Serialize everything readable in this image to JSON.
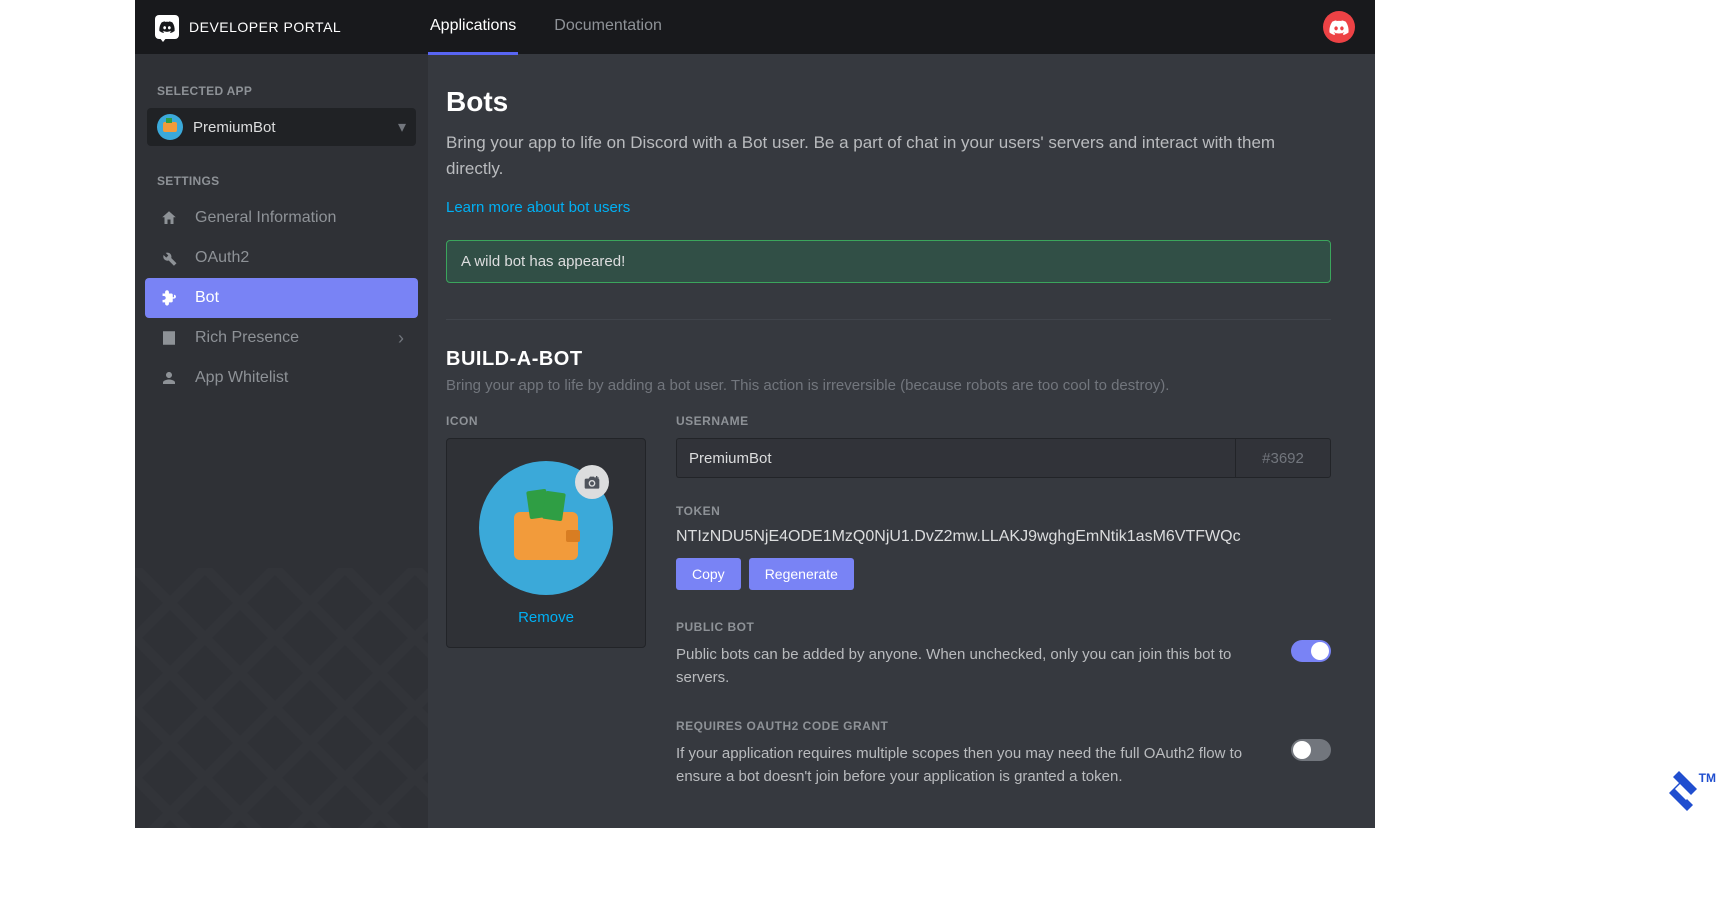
{
  "header": {
    "portal_title": "DEVELOPER PORTAL",
    "tabs": {
      "applications": "Applications",
      "documentation": "Documentation"
    }
  },
  "sidebar": {
    "selected_app_label": "SELECTED APP",
    "selected_app_name": "PremiumBot",
    "settings_label": "SETTINGS",
    "items": [
      {
        "label": "General Information"
      },
      {
        "label": "OAuth2"
      },
      {
        "label": "Bot"
      },
      {
        "label": "Rich Presence"
      },
      {
        "label": "App Whitelist"
      }
    ]
  },
  "main": {
    "title": "Bots",
    "description": "Bring your app to life on Discord with a Bot user. Be a part of chat in your users' servers and interact with them directly.",
    "learn_more": "Learn more about bot users",
    "alert": "A wild bot has appeared!",
    "build": {
      "title": "BUILD-A-BOT",
      "subtitle": "Bring your app to life by adding a bot user. This action is irreversible (because robots are too cool to destroy).",
      "icon_label": "ICON",
      "remove": "Remove",
      "username_label": "USERNAME",
      "username_value": "PremiumBot",
      "discriminator": "#3692",
      "token_label": "TOKEN",
      "token_value": "NTIzNDU5NjE4ODE1MzQ0NjU1.DvZ2mw.LLAKJ9wghgEmNtik1asM6VTFWQc",
      "copy": "Copy",
      "regenerate": "Regenerate"
    },
    "public_bot": {
      "label": "PUBLIC BOT",
      "desc": "Public bots can be added by anyone. When unchecked, only you can join this bot to servers."
    },
    "oauth_grant": {
      "label": "REQUIRES OAUTH2 CODE GRANT",
      "desc": "If your application requires multiple scopes then you may need the full OAuth2 flow to ensure a bot doesn't join before your application is granted a token."
    }
  }
}
